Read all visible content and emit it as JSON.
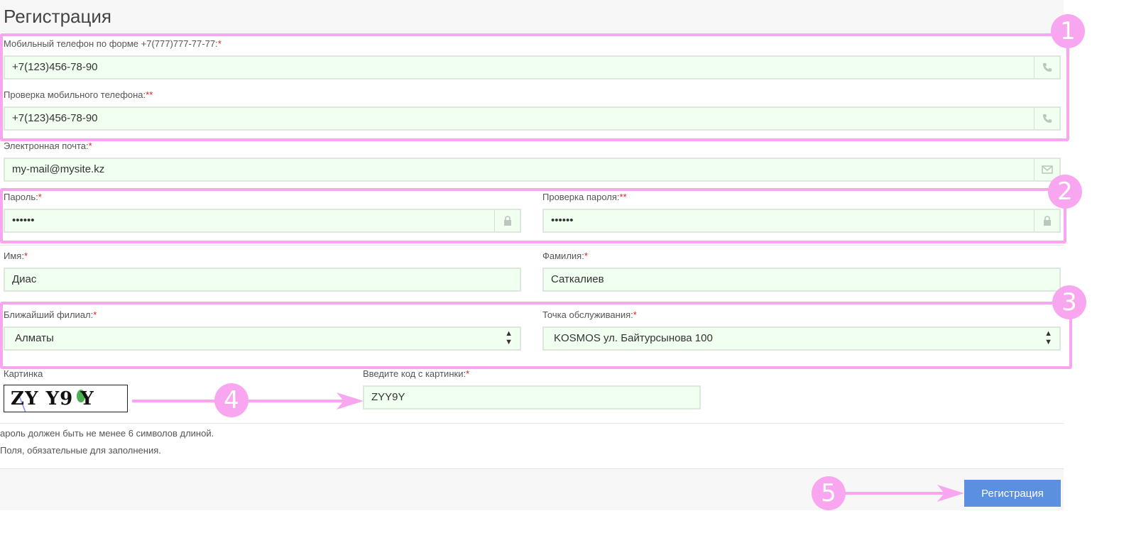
{
  "page": {
    "title": "Регистрация"
  },
  "phone": {
    "label": "Мобильный телефон по форме +7(777)777-77-77:",
    "req": "*",
    "value": "+7(123)456-78-90",
    "icon": "phone-icon"
  },
  "phone_check": {
    "label": "Проверка мобильного телефона:",
    "req": "**",
    "value": "+7(123)456-78-90",
    "icon": "phone-icon"
  },
  "email": {
    "label": "Электронная почта:",
    "req": "*",
    "value": "my-mail@mysite.kz",
    "icon": "envelope-icon"
  },
  "password": {
    "label": "Пароль:",
    "req": "*",
    "value": "••••••",
    "icon": "lock-icon"
  },
  "password_check": {
    "label": "Проверка пароля:",
    "req": "**",
    "value": "••••••",
    "icon": "lock-icon"
  },
  "first_name": {
    "label": "Имя:",
    "req": "*",
    "value": "Диас"
  },
  "last_name": {
    "label": "Фамилия:",
    "req": "*",
    "value": "Саткалиев"
  },
  "branch": {
    "label": "Ближайший филиал:",
    "req": "*",
    "value": "Алматы"
  },
  "service_point": {
    "label": "Точка обслуживания:",
    "req": "*",
    "value": "KOSMOS ул. Байтурсынова 100"
  },
  "captcha": {
    "label": "Картинка",
    "image_text": "ZY Y9 Y",
    "input_label": "Введите код с картинки:",
    "req": "*",
    "value": "ZYY9Y"
  },
  "notes": {
    "password_rule": "ароль должен быть не менее 6 символов длиной.",
    "required_note": "Поля, обязательные для заполнения."
  },
  "submit": {
    "label": "Регистрация"
  },
  "annotations": {
    "b1": "1",
    "b2": "2",
    "b3": "3",
    "b4": "4",
    "b5": "5"
  },
  "colors": {
    "highlight": "#f9a6f0",
    "input_bg": "#f0fff0",
    "button": "#5b8fe0",
    "required": "#e02020"
  }
}
